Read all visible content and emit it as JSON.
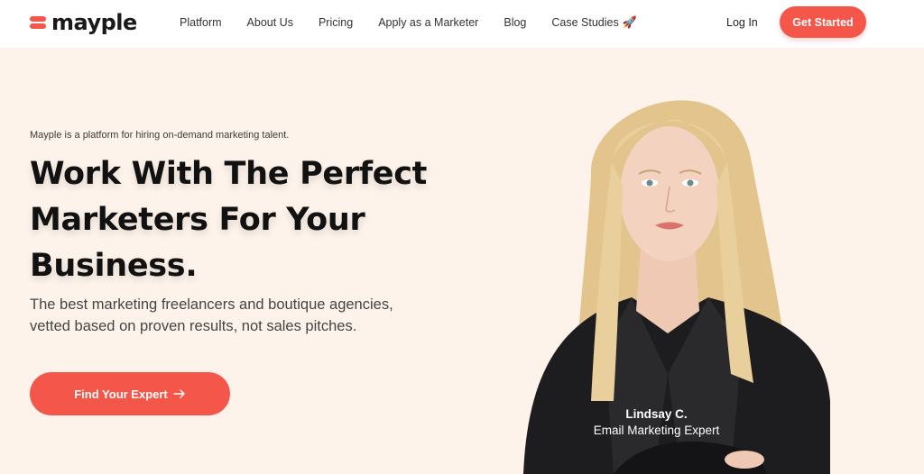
{
  "brand": {
    "name": "mayple",
    "accent": "#f4574a"
  },
  "nav": {
    "items": [
      {
        "label": "Platform"
      },
      {
        "label": "About Us"
      },
      {
        "label": "Pricing"
      },
      {
        "label": "Apply as a Marketer"
      },
      {
        "label": "Blog"
      },
      {
        "label": "Case Studies",
        "icon": "rocket-icon"
      }
    ],
    "login_label": "Log In",
    "cta_label": "Get Started"
  },
  "hero": {
    "tagline": "Mayple is a platform for hiring on-demand marketing talent.",
    "headline_line1": "Work With The Perfect",
    "headline_line2": "Marketers For Your",
    "headline_line3": "Business.",
    "subtext_line1": "The best marketing freelancers and boutique agencies,",
    "subtext_line2": "vetted based on proven results, not sales pitches.",
    "cta_label": "Find Your Expert",
    "cta_icon": "arrow-right-icon"
  },
  "expert": {
    "name": "Lindsay C.",
    "role": "Email Marketing Expert"
  }
}
